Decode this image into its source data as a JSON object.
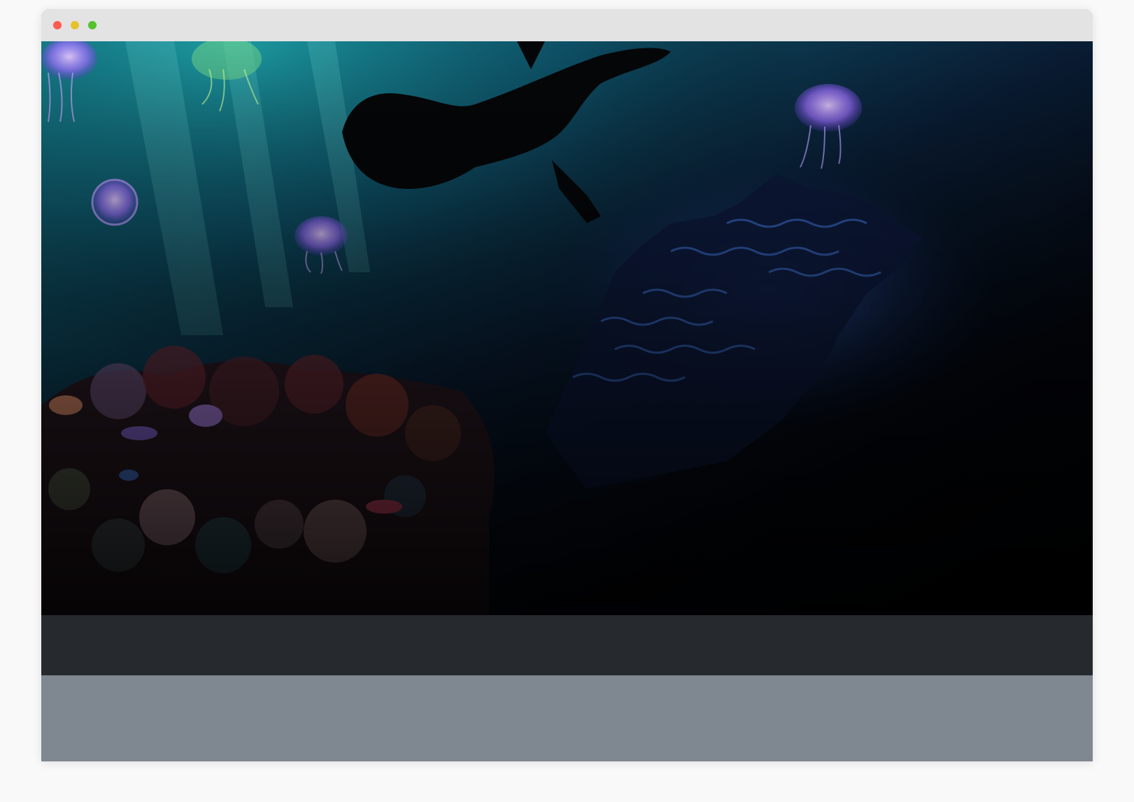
{
  "window": {
    "controls": [
      "close",
      "minimize",
      "maximize"
    ]
  },
  "hero": {
    "scene": "underwater-scene",
    "colors": {
      "water_top": "#0e5f69",
      "water_mid": "#0b2a3f",
      "deep": "#000000",
      "jelly": "#a77bff",
      "coral_glow": "#3f6fd6"
    }
  },
  "bands": {
    "dark": "#26292e",
    "grey": "#7f8790"
  }
}
